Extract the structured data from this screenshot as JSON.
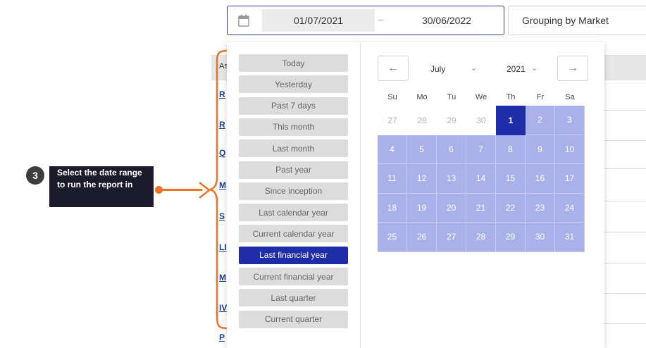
{
  "date_range": {
    "start": "01/07/2021",
    "separator": "–",
    "end": "30/06/2022"
  },
  "grouping": {
    "label": "Grouping by Market"
  },
  "background_table": {
    "header_text": "As",
    "row_links": [
      "R",
      "R",
      "Q",
      "M",
      "S",
      "LI",
      "M",
      "IV",
      "P"
    ]
  },
  "presets": [
    {
      "label": "Today",
      "active": false
    },
    {
      "label": "Yesterday",
      "active": false
    },
    {
      "label": "Past 7 days",
      "active": false
    },
    {
      "label": "This month",
      "active": false
    },
    {
      "label": "Last month",
      "active": false
    },
    {
      "label": "Past year",
      "active": false
    },
    {
      "label": "Since inception",
      "active": false
    },
    {
      "label": "Last calendar year",
      "active": false
    },
    {
      "label": "Current calendar year",
      "active": false
    },
    {
      "label": "Last financial year",
      "active": true
    },
    {
      "label": "Current financial year",
      "active": false
    },
    {
      "label": "Last quarter",
      "active": false
    },
    {
      "label": "Current quarter",
      "active": false
    }
  ],
  "calendar": {
    "prev_icon": "←",
    "next_icon": "→",
    "month": "July",
    "year": "2021",
    "chevron": "⌄",
    "weekdays": [
      "Su",
      "Mo",
      "Tu",
      "We",
      "Th",
      "Fr",
      "Sa"
    ],
    "weeks": [
      [
        {
          "d": "27",
          "s": "muted"
        },
        {
          "d": "28",
          "s": "muted"
        },
        {
          "d": "29",
          "s": "muted"
        },
        {
          "d": "30",
          "s": "muted"
        },
        {
          "d": "1",
          "s": "selected"
        },
        {
          "d": "2",
          "s": "inrange"
        },
        {
          "d": "3",
          "s": "inrange"
        }
      ],
      [
        {
          "d": "4",
          "s": "inrange"
        },
        {
          "d": "5",
          "s": "inrange"
        },
        {
          "d": "6",
          "s": "inrange"
        },
        {
          "d": "7",
          "s": "inrange"
        },
        {
          "d": "8",
          "s": "inrange"
        },
        {
          "d": "9",
          "s": "inrange"
        },
        {
          "d": "10",
          "s": "inrange"
        }
      ],
      [
        {
          "d": "11",
          "s": "inrange"
        },
        {
          "d": "12",
          "s": "inrange"
        },
        {
          "d": "13",
          "s": "inrange"
        },
        {
          "d": "14",
          "s": "inrange"
        },
        {
          "d": "15",
          "s": "inrange"
        },
        {
          "d": "16",
          "s": "inrange"
        },
        {
          "d": "17",
          "s": "inrange"
        }
      ],
      [
        {
          "d": "18",
          "s": "inrange"
        },
        {
          "d": "19",
          "s": "inrange"
        },
        {
          "d": "20",
          "s": "inrange"
        },
        {
          "d": "21",
          "s": "inrange"
        },
        {
          "d": "22",
          "s": "inrange"
        },
        {
          "d": "23",
          "s": "inrange"
        },
        {
          "d": "24",
          "s": "inrange"
        }
      ],
      [
        {
          "d": "25",
          "s": "inrange"
        },
        {
          "d": "26",
          "s": "inrange"
        },
        {
          "d": "27",
          "s": "inrange"
        },
        {
          "d": "28",
          "s": "inrange"
        },
        {
          "d": "29",
          "s": "inrange"
        },
        {
          "d": "30",
          "s": "inrange"
        },
        {
          "d": "31",
          "s": "inrange"
        }
      ]
    ]
  },
  "annotation": {
    "step_number": "3",
    "text": "Select the date range to run the report in"
  },
  "colors": {
    "accent": "#1f2ea8",
    "range": "#a9b1e8",
    "annotation": "#f07222"
  }
}
